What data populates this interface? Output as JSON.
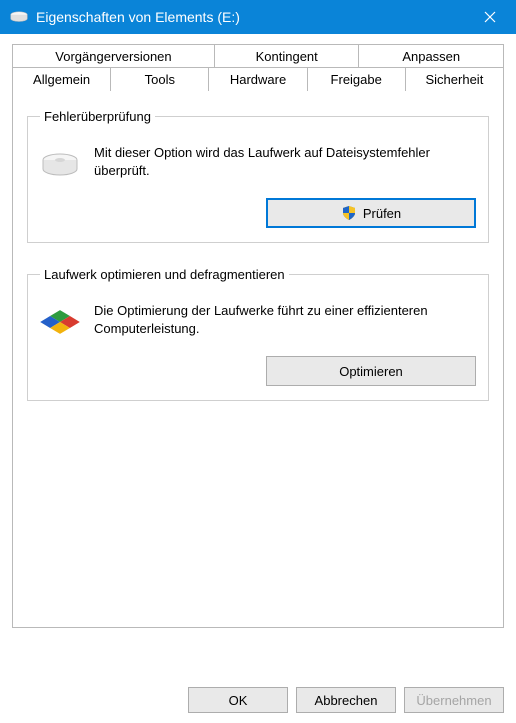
{
  "window": {
    "title": "Eigenschaften von Elements (E:)",
    "close_label": "×"
  },
  "tabs": {
    "row1": [
      {
        "label": "Vorgängerversionen"
      },
      {
        "label": "Kontingent"
      },
      {
        "label": "Anpassen"
      }
    ],
    "row2": [
      {
        "label": "Allgemein"
      },
      {
        "label": "Tools"
      },
      {
        "label": "Hardware"
      },
      {
        "label": "Freigabe"
      },
      {
        "label": "Sicherheit"
      }
    ]
  },
  "error_check": {
    "legend": "Fehlerüberprüfung",
    "text": "Mit dieser Option wird das Laufwerk auf Dateisystemfehler überprüft.",
    "button": "Prüfen"
  },
  "optimize": {
    "legend": "Laufwerk optimieren und defragmentieren",
    "text": "Die Optimierung der Laufwerke führt zu einer effizienteren Computerleistung.",
    "button": "Optimieren"
  },
  "footer": {
    "ok": "OK",
    "cancel": "Abbrechen",
    "apply": "Übernehmen"
  }
}
